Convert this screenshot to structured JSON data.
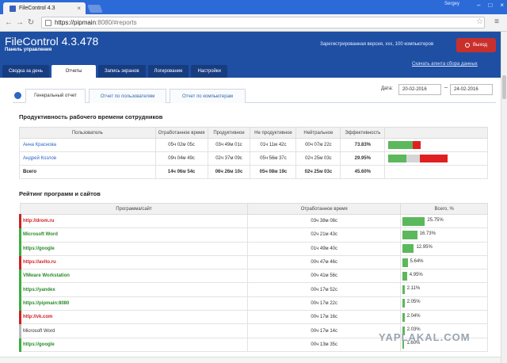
{
  "browser": {
    "tab_title": "FileControl 4.3",
    "user": "Sergey",
    "url_host": "https://pipmain",
    "url_rest": ":8080/#reports"
  },
  "header": {
    "title": "FileControl 4.3.478",
    "subtitle": "Панель управления",
    "registration": "Зарегистрированная версия, ххх, 100 компьютеров",
    "logout_label": "Выход",
    "download_label": "Скачать агента сбора данных"
  },
  "nav_tabs": [
    {
      "label": "Сводка за день"
    },
    {
      "label": "Отчеты"
    },
    {
      "label": "Запись экранов"
    },
    {
      "label": "Логирование"
    },
    {
      "label": "Настройки"
    }
  ],
  "sub_tabs": [
    {
      "label": "Генеральный отчет"
    },
    {
      "label": "Отчет по пользователям"
    },
    {
      "label": "Отчет по компьютерам"
    }
  ],
  "dates": {
    "label": "Дата:",
    "from": "20-02-2016",
    "separator": "–",
    "to": "24-02-2016"
  },
  "productivity": {
    "title": "Продуктивность рабочего времени сотрудников",
    "headers": [
      "Пользователь",
      "Отработанное время",
      "Продуктивное",
      "Не продуктивное",
      "Нейтральное",
      "Эффективность"
    ],
    "rows": [
      {
        "user": "Анна Краснова",
        "worked": "05ч 02м 05с",
        "prod": "03ч 49м 01с",
        "nonprod": "01ч 11м 42с",
        "neutral": "00ч 07м 22с",
        "eff": "73.83%",
        "bar": {
          "green": 0.38,
          "gray": 0.0,
          "red": 0.13
        }
      },
      {
        "user": "Андрей Козлов",
        "worked": "09ч 04м 49с",
        "prod": "02ч 37м 09с",
        "nonprod": "05ч 56м 37с",
        "neutral": "02ч 25м 03с",
        "eff": "29.95%",
        "bar": {
          "green": 0.28,
          "gray": 0.22,
          "red": 0.43
        }
      }
    ],
    "total": {
      "label": "Всего",
      "worked": "14ч 06м 54с",
      "prod": "06ч 26м 10с",
      "nonprod": "05ч 08м 19с",
      "neutral": "02ч 25м 03с",
      "eff": "45.60%"
    }
  },
  "ranking": {
    "title": "Рейтинг программ и сайтов",
    "headers": [
      "Программа/сайт",
      "Отработанное время",
      "Всего, %"
    ],
    "rows": [
      {
        "site": "http://drom.ru",
        "kind": "red",
        "time": "03ч 38м 08с",
        "pct": "25.75%",
        "value": 25.75
      },
      {
        "site": "Microsoft Word",
        "kind": "green",
        "time": "02ч 21м 43с",
        "pct": "16.73%",
        "value": 16.73
      },
      {
        "site": "https://google",
        "kind": "green",
        "time": "01ч 49м 40с",
        "pct": "12.95%",
        "value": 12.95
      },
      {
        "site": "https://avito.ru",
        "kind": "red",
        "time": "00ч 47м 46с",
        "pct": "5.64%",
        "value": 5.64
      },
      {
        "site": "VMware Workstation",
        "kind": "green",
        "time": "00ч 41м 56с",
        "pct": "4.95%",
        "value": 4.95
      },
      {
        "site": "https://yandex",
        "kind": "green",
        "time": "00ч 17м 52с",
        "pct": "2.11%",
        "value": 2.11
      },
      {
        "site": "https://pipmain:8080",
        "kind": "green",
        "time": "00ч 17м 22с",
        "pct": "2.05%",
        "value": 2.05
      },
      {
        "site": "http://vk.com",
        "kind": "red",
        "time": "00ч 17м 16с",
        "pct": "2.04%",
        "value": 2.04
      },
      {
        "site": "Microsoft Word",
        "kind": "plain",
        "time": "00ч 17м 14с",
        "pct": "2.03%",
        "value": 2.03
      },
      {
        "site": "https://google",
        "kind": "green",
        "time": "00ч 13м 35с",
        "pct": "1.60%",
        "value": 1.6
      }
    ]
  },
  "watermark": "YAPLAKAL.COM"
}
